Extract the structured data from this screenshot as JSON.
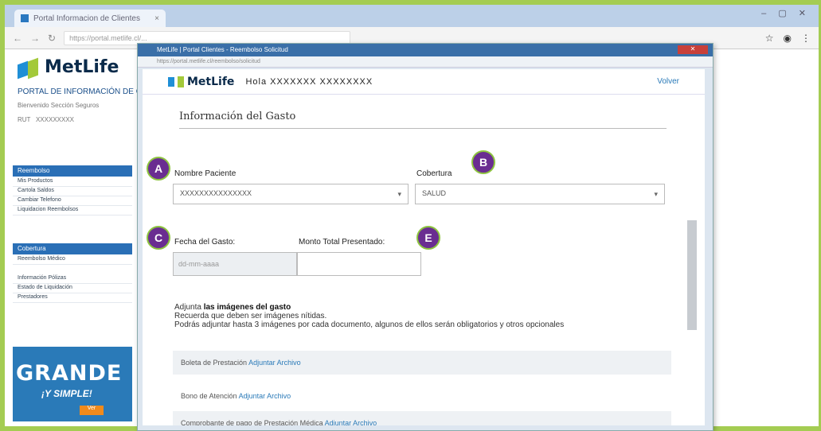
{
  "browser": {
    "tab_title": "Portal Informacion de Clientes",
    "tab_close": "×",
    "window_controls": "‒ ▢ ✕",
    "address": "https://portal.metlife.cl/..."
  },
  "portal": {
    "logo_text": "MetLife",
    "title": "PORTAL DE INFORMACIÓN DE CLIENTES",
    "subtitle": "Bienvenido Sección Seguros",
    "rut_label": "RUT",
    "rut_value": "XXXXXXXXX",
    "menu_1_head": "Reembolso",
    "menu_1_items": [
      "Mis Productos",
      "Cartola Saldos",
      "Cambiar Telefono",
      "Liquidacion Reembolsos"
    ],
    "menu_2_head": "Cobertura",
    "menu_2_items": [
      "Reembolso Médico",
      "Información Pólizas",
      "Estado de Liquidación",
      "Prestadores"
    ],
    "promo_big": "GRANDE",
    "promo_small": "¡Y SIMPLE!",
    "promo_button": "Ver"
  },
  "popup": {
    "titlebar": "MetLife | Portal Clientes - Reembolso Solicitud",
    "close_label": "✕",
    "url": "https://portal.metlife.cl/reembolso/solicitud",
    "logo_text": "MetLife",
    "greeting": "Hola XXXXXXX XXXXXXXX",
    "back_link": "Volver",
    "section_title": "Información del Gasto",
    "patient_label": "Nombre Paciente",
    "patient_value": "XXXXXXXXXXXXXXX",
    "coverage_label": "Cobertura",
    "coverage_value": "SALUD",
    "date_label": "Fecha del Gasto:",
    "date_value": "dd-mm-aaaa",
    "amount_label": "Monto Total Presentado:",
    "amount_value": "",
    "attach_prefix": "Adjunta ",
    "attach_bold": "las imágenes del gasto",
    "attach_line2": "Recuerda que deben ser imágenes nítidas.",
    "attach_line3": "Podrás adjuntar hasta 3 imágenes por cada documento, algunos de ellos serán obligatorios y otros opcionales",
    "docs": [
      {
        "label": "Boleta de Prestación ",
        "link": "Adjuntar Archivo"
      },
      {
        "label": "Bono de Atención ",
        "link": "Adjuntar Archivo"
      },
      {
        "label": "Comprobante de pago de Prestación Médica ",
        "link": "Adjuntar Archivo"
      }
    ]
  },
  "badges": [
    "A",
    "B",
    "C",
    "E"
  ],
  "colors": {
    "badge_fill": "#6a2d91",
    "badge_ring": "#8dc43f",
    "frame": "#a4cc52",
    "brand_blue": "#1f8fd6",
    "brand_green": "#a3c93a"
  }
}
